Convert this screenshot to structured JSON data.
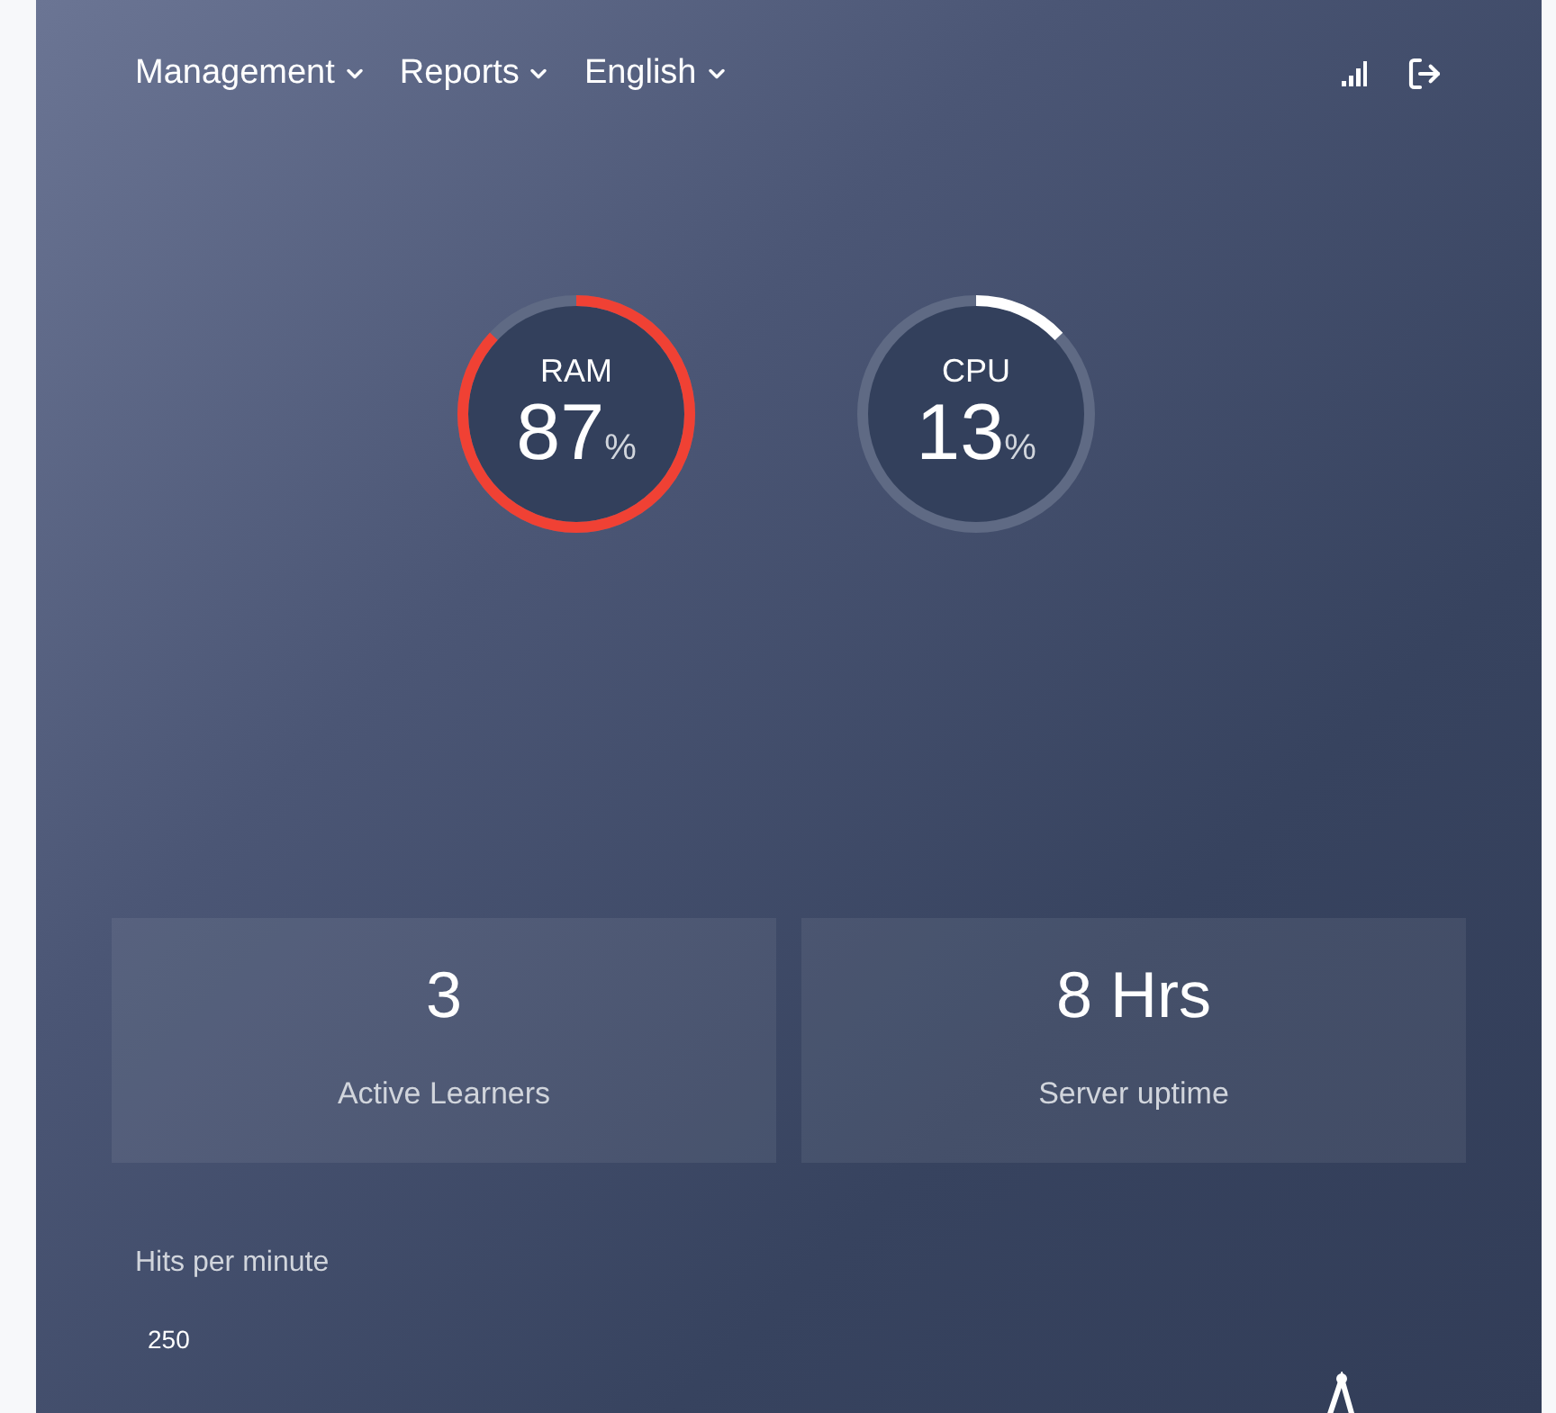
{
  "nav": {
    "menus": [
      {
        "label": "Management"
      },
      {
        "label": "Reports"
      },
      {
        "label": "English"
      }
    ]
  },
  "gauges": [
    {
      "label": "RAM",
      "value": "87",
      "unit": "%",
      "level": 0.87,
      "color": "#f04134"
    },
    {
      "label": "CPU",
      "value": "13",
      "unit": "%",
      "level": 0.13,
      "color": "#ffffff"
    }
  ],
  "stats": [
    {
      "value": "3",
      "label": "Active Learners"
    },
    {
      "value": "8 Hrs",
      "label": "Server uptime"
    }
  ],
  "hits_chart": {
    "title": "Hits per minute",
    "tick": "250"
  }
}
